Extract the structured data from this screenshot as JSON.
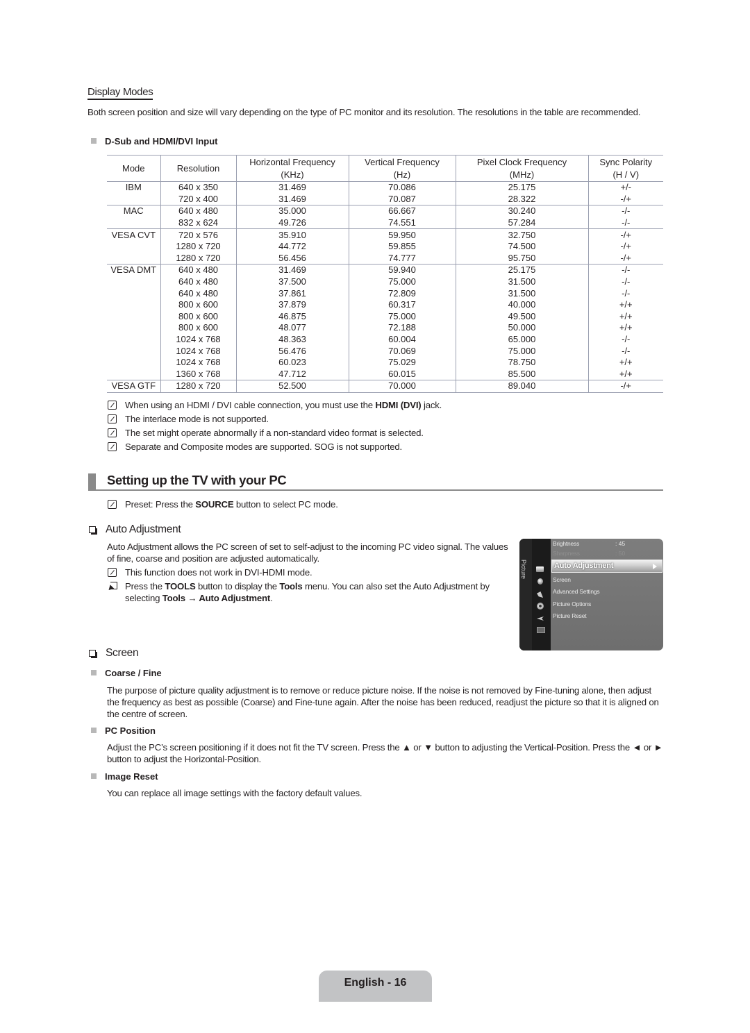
{
  "display_modes": {
    "title": "Display Modes",
    "intro": "Both screen position and size will vary depending on the type of PC monitor and its resolution. The resolutions in the table are recommended.",
    "input_heading": "D-Sub and HDMI/DVI Input",
    "table": {
      "headers": [
        {
          "line1": "Mode",
          "line2": ""
        },
        {
          "line1": "Resolution",
          "line2": ""
        },
        {
          "line1": "Horizontal Frequency",
          "line2": "(KHz)"
        },
        {
          "line1": "Vertical Frequency",
          "line2": "(Hz)"
        },
        {
          "line1": "Pixel Clock Frequency",
          "line2": "(MHz)"
        },
        {
          "line1": "Sync Polarity",
          "line2": "(H / V)"
        }
      ],
      "rows": [
        {
          "mode": "IBM",
          "resolution": "640 x 350",
          "h_freq": "31.469",
          "v_freq": "70.086",
          "pixel_clock": "25.175",
          "sync": "+/-"
        },
        {
          "mode": "",
          "resolution": "720 x 400",
          "h_freq": "31.469",
          "v_freq": "70.087",
          "pixel_clock": "28.322",
          "sync": "-/+"
        },
        {
          "mode": "MAC",
          "resolution": "640 x 480",
          "h_freq": "35.000",
          "v_freq": "66.667",
          "pixel_clock": "30.240",
          "sync": "-/-"
        },
        {
          "mode": "",
          "resolution": "832 x 624",
          "h_freq": "49.726",
          "v_freq": "74.551",
          "pixel_clock": "57.284",
          "sync": "-/-"
        },
        {
          "mode": "VESA CVT",
          "resolution": "720 x 576",
          "h_freq": "35.910",
          "v_freq": "59.950",
          "pixel_clock": "32.750",
          "sync": "-/+"
        },
        {
          "mode": "",
          "resolution": "1280 x 720",
          "h_freq": "44.772",
          "v_freq": "59.855",
          "pixel_clock": "74.500",
          "sync": "-/+"
        },
        {
          "mode": "",
          "resolution": "1280 x 720",
          "h_freq": "56.456",
          "v_freq": "74.777",
          "pixel_clock": "95.750",
          "sync": "-/+"
        },
        {
          "mode": "VESA DMT",
          "resolution": "640 x 480",
          "h_freq": "31.469",
          "v_freq": "59.940",
          "pixel_clock": "25.175",
          "sync": "-/-"
        },
        {
          "mode": "",
          "resolution": "640 x 480",
          "h_freq": "37.500",
          "v_freq": "75.000",
          "pixel_clock": "31.500",
          "sync": "-/-"
        },
        {
          "mode": "",
          "resolution": "640 x 480",
          "h_freq": "37.861",
          "v_freq": "72.809",
          "pixel_clock": "31.500",
          "sync": "-/-"
        },
        {
          "mode": "",
          "resolution": "800 x 600",
          "h_freq": "37.879",
          "v_freq": "60.317",
          "pixel_clock": "40.000",
          "sync": "+/+"
        },
        {
          "mode": "",
          "resolution": "800 x 600",
          "h_freq": "46.875",
          "v_freq": "75.000",
          "pixel_clock": "49.500",
          "sync": "+/+"
        },
        {
          "mode": "",
          "resolution": "800 x 600",
          "h_freq": "48.077",
          "v_freq": "72.188",
          "pixel_clock": "50.000",
          "sync": "+/+"
        },
        {
          "mode": "",
          "resolution": "1024 x 768",
          "h_freq": "48.363",
          "v_freq": "60.004",
          "pixel_clock": "65.000",
          "sync": "-/-"
        },
        {
          "mode": "",
          "resolution": "1024 x 768",
          "h_freq": "56.476",
          "v_freq": "70.069",
          "pixel_clock": "75.000",
          "sync": "-/-"
        },
        {
          "mode": "",
          "resolution": "1024 x 768",
          "h_freq": "60.023",
          "v_freq": "75.029",
          "pixel_clock": "78.750",
          "sync": "+/+"
        },
        {
          "mode": "",
          "resolution": "1360 x 768",
          "h_freq": "47.712",
          "v_freq": "60.015",
          "pixel_clock": "85.500",
          "sync": "+/+"
        },
        {
          "mode": "VESA GTF",
          "resolution": "1280 x 720",
          "h_freq": "52.500",
          "v_freq": "70.000",
          "pixel_clock": "89.040",
          "sync": "-/+"
        }
      ]
    },
    "notes": [
      {
        "pre": "When using an HDMI / DVI cable connection, you must use the ",
        "bold": "HDMI (DVI)",
        "post": " jack."
      },
      {
        "pre": "The interlace mode is not supported.",
        "bold": "",
        "post": ""
      },
      {
        "pre": "The set might operate abnormally if a non-standard video format is selected.",
        "bold": "",
        "post": ""
      },
      {
        "pre": "Separate and Composite modes are supported. SOG is not supported.",
        "bold": "",
        "post": ""
      }
    ]
  },
  "setup": {
    "title": "Setting up the TV with your PC",
    "preset_note": {
      "pre": "Preset: Press the ",
      "bold": "SOURCE",
      "post": " button to select PC mode."
    }
  },
  "auto_adjustment": {
    "heading": "Auto Adjustment",
    "body": "Auto Adjustment allows the PC screen of set to self-adjust to the incoming PC video signal. The values of fine, coarse and position are adjusted automatically.",
    "note": "This function does not work in DVI-HDMI mode.",
    "tools": {
      "t1": "Press the ",
      "b1": "TOOLS",
      "t2": " button to display the ",
      "b2": "Tools",
      "t3": " menu. You can also set the Auto Adjustment by selecting ",
      "b3": "Tools → Auto Adjustment",
      "t4": "."
    }
  },
  "tv_menu": {
    "category": "Picture",
    "items": [
      {
        "label": "Brightness",
        "value": ": 45"
      },
      {
        "label": "Sharpness",
        "value": ": 50"
      },
      {
        "label": "Auto Adjustment",
        "value": ""
      },
      {
        "label": "Screen",
        "value": ""
      },
      {
        "label": "Advanced Settings",
        "value": ""
      },
      {
        "label": "Picture Options",
        "value": ""
      },
      {
        "label": "Picture Reset",
        "value": ""
      }
    ],
    "selected_index": 2,
    "icons": [
      "picture-icon",
      "sound-icon",
      "channel-icon",
      "setup-icon",
      "input-icon",
      "support-icon"
    ]
  },
  "screen": {
    "heading": "Screen",
    "coarse_fine": {
      "title": "Coarse / Fine",
      "body": "The purpose of picture quality adjustment is to remove or reduce picture noise. If the noise is not removed by Fine-tuning alone, then adjust the frequency as best as possible (Coarse) and Fine-tune again. After the noise has been reduced, readjust the picture so that it is aligned on the centre of screen."
    },
    "pc_position": {
      "title": "PC Position",
      "body": "Adjust the PC’s screen positioning if it does not fit the TV screen. Press the ▲ or ▼ button to adjusting the Vertical-Position. Press the ◄ or ► button to adjust the Horizontal-Position."
    },
    "image_reset": {
      "title": "Image Reset",
      "body": "You can replace all image settings with the factory default values."
    }
  },
  "footer": {
    "page_label": "English - 16"
  }
}
